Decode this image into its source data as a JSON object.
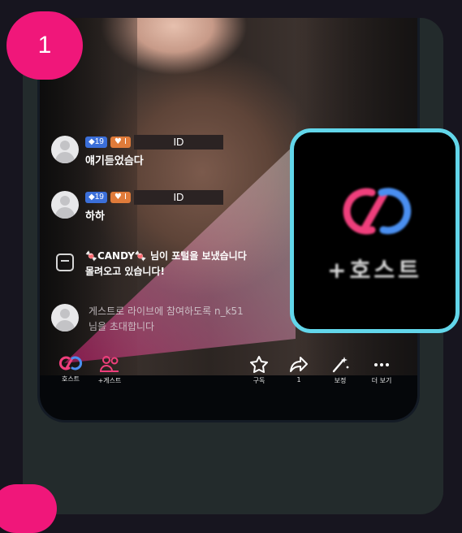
{
  "step": {
    "number": "1"
  },
  "comments": [
    {
      "level": "19",
      "heart": "I",
      "user_id": "ID",
      "text": "얘기듣었슴다"
    },
    {
      "level": "19",
      "heart": "I",
      "user_id": "ID",
      "text": "하하"
    }
  ],
  "gift_notice": {
    "candy": "🍬CANDY🍬",
    "line1": " 님이 포털을 보냈습니다",
    "line2": "몰려오고 있습니다!"
  },
  "guest_notice": {
    "line1": "게스트로 라이브에 참여하도록 n_k51",
    "line2": "님을 초대합니다"
  },
  "toolbar": {
    "host_label": "호스트",
    "guest_label": "+게스트",
    "subscribe_label": "구독",
    "share_label": "1",
    "edit_label": "보정",
    "more_label": "더 보기"
  },
  "callout": {
    "label": "+호스트"
  },
  "colors": {
    "accent_pink": "#f0177a",
    "callout_border": "#62d6ea",
    "icon_pink": "#ef3f7c",
    "icon_blue": "#4a8ff0"
  }
}
